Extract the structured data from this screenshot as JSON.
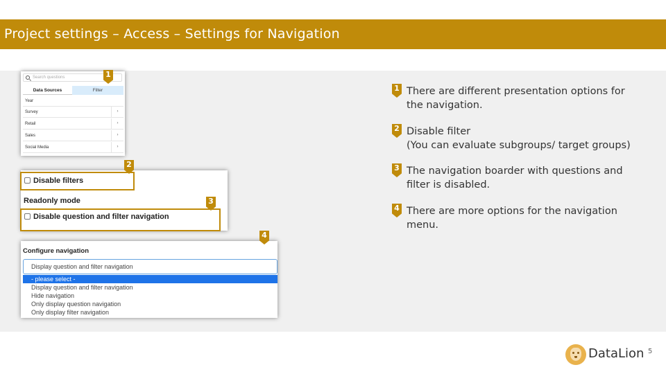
{
  "title": "Project settings – Access – Settings for Navigation",
  "panel1": {
    "search_placeholder": "Search questions",
    "tabs": [
      "Data Sources",
      "Filter"
    ],
    "rows": [
      {
        "label": "Year",
        "chevron": ""
      },
      {
        "label": "Survey",
        "chevron": "›"
      },
      {
        "label": "Retail",
        "chevron": "›"
      },
      {
        "label": "Sales",
        "chevron": "›"
      },
      {
        "label": "Social Media",
        "chevron": "›"
      }
    ]
  },
  "panel2": {
    "disable_filters": "Disable filters",
    "readonly_mode": "Readonly mode",
    "disable_question_filter_nav": "Disable question and filter navigation"
  },
  "panel3": {
    "label": "Configure navigation",
    "selected_value": "Display question and filter navigation",
    "options": [
      "- please select -",
      "Display question and filter navigation",
      "Hide navigation",
      "Only display question navigation",
      "Only display filter navigation"
    ]
  },
  "markers": [
    "1",
    "2",
    "3",
    "4"
  ],
  "items": [
    {
      "num": "1",
      "lines": [
        "There are different presentation options for",
        "the navigation."
      ]
    },
    {
      "num": "2",
      "lines": [
        "Disable filter",
        "(You can evaluate subgroups/ target groups)"
      ]
    },
    {
      "num": "3",
      "lines": [
        "The navigation boarder with questions and",
        "filter is disabled."
      ]
    },
    {
      "num": "4",
      "lines": [
        "There are more options for the navigation",
        "menu."
      ]
    }
  ],
  "logo": {
    "text": "DataLion"
  },
  "page_number": "5",
  "colors": {
    "accent": "#c08b0a",
    "selection": "#1e73e8",
    "filter_tab": "#d9ecfb",
    "content_bg": "#f0f0f0"
  }
}
